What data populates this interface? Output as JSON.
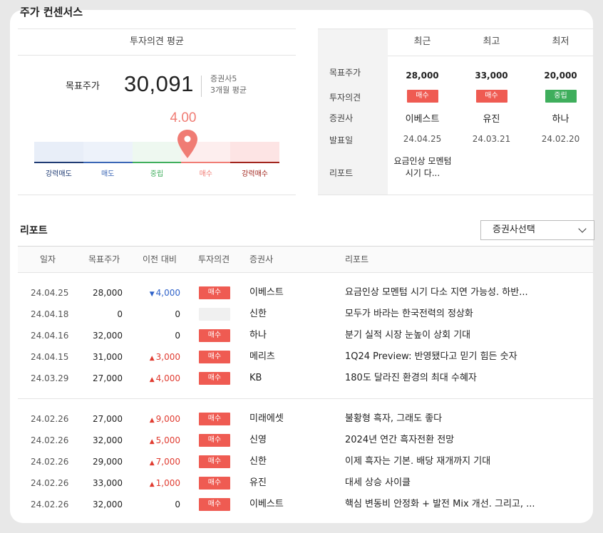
{
  "section_title": "주가 컨센서스",
  "opinion": {
    "title": "투자의견 평균",
    "target_label": "목표주가",
    "target_value": "30,091",
    "meta_line1": "증권사5",
    "meta_line2": "3개월 평균",
    "score": "4.00",
    "score_fraction": 0.625,
    "gauge": [
      {
        "label": "강력매도",
        "bg": "#e8eef8",
        "bar": "#1f3b73",
        "text": "#1f3b73"
      },
      {
        "label": "매도",
        "bg": "#edf2fa",
        "bar": "#3a66b5",
        "text": "#3a66b5"
      },
      {
        "label": "중립",
        "bg": "#eef8f0",
        "bar": "#3fae5c",
        "text": "#3fae5c"
      },
      {
        "label": "매수",
        "bg": "#fdeeee",
        "bar": "#f07c74",
        "text": "#f07c74"
      },
      {
        "label": "강력매수",
        "bg": "#fde4e4",
        "bar": "#a1241c",
        "text": "#a1241c"
      }
    ]
  },
  "summary": {
    "headers": [
      "최근",
      "최고",
      "최저"
    ],
    "row_labels": [
      "목표주가",
      "투자의견",
      "증권사",
      "발표일",
      "리포트"
    ],
    "columns": [
      {
        "target": "28,000",
        "opinion": "매수",
        "opinion_type": "buy",
        "firm": "이베스트",
        "date": "24.04.25",
        "report": "요금인상 모멘텀 시기 다..."
      },
      {
        "target": "33,000",
        "opinion": "매수",
        "opinion_type": "buy",
        "firm": "유진",
        "date": "24.03.21",
        "report": ""
      },
      {
        "target": "20,000",
        "opinion": "중립",
        "opinion_type": "neutral",
        "firm": "하나",
        "date": "24.02.20",
        "report": ""
      }
    ]
  },
  "reports": {
    "title": "리포트",
    "select_label": "증권사선택",
    "headers": {
      "date": "일자",
      "target": "목표주가",
      "change": "이전 대비",
      "opinion": "투자의견",
      "firm": "증권사",
      "report": "리포트"
    },
    "rows": [
      {
        "date": "24.04.25",
        "target": "28,000",
        "change": "4,000",
        "dir": "down",
        "opinion": "매수",
        "firm": "이베스트",
        "report": "요금인상 모멘텀 시기 다소 지연 가능성. 하반..."
      },
      {
        "date": "24.04.18",
        "target": "0",
        "change": "0",
        "dir": "flat",
        "opinion": "",
        "firm": "신한",
        "report": "모두가 바라는 한국전력의 정상화"
      },
      {
        "date": "24.04.16",
        "target": "32,000",
        "change": "0",
        "dir": "flat",
        "opinion": "매수",
        "firm": "하나",
        "report": "분기 실적 시장 눈높이 상회 기대"
      },
      {
        "date": "24.04.15",
        "target": "31,000",
        "change": "3,000",
        "dir": "up",
        "opinion": "매수",
        "firm": "메리츠",
        "report": "1Q24 Preview: 반영됐다고 믿기 힘든 숫자"
      },
      {
        "date": "24.03.29",
        "target": "27,000",
        "change": "4,000",
        "dir": "up",
        "opinion": "매수",
        "firm": "KB",
        "report": "180도 달라진 환경의 최대 수혜자"
      },
      {
        "date": "24.02.26",
        "target": "27,000",
        "change": "9,000",
        "dir": "up",
        "opinion": "매수",
        "firm": "미래에셋",
        "report": "불황형 흑자, 그래도 좋다"
      },
      {
        "date": "24.02.26",
        "target": "32,000",
        "change": "5,000",
        "dir": "up",
        "opinion": "매수",
        "firm": "신영",
        "report": "2024년 연간 흑자전환 전망"
      },
      {
        "date": "24.02.26",
        "target": "29,000",
        "change": "7,000",
        "dir": "up",
        "opinion": "매수",
        "firm": "신한",
        "report": "이제 흑자는 기본. 배당 재개까지 기대"
      },
      {
        "date": "24.02.26",
        "target": "33,000",
        "change": "1,000",
        "dir": "up",
        "opinion": "매수",
        "firm": "유진",
        "report": "대세 상승 사이클"
      },
      {
        "date": "24.02.26",
        "target": "32,000",
        "change": "0",
        "dir": "flat",
        "opinion": "매수",
        "firm": "이베스트",
        "report": "핵심 변동비 안정화 + 발전 Mix 개선. 그리고, ..."
      }
    ]
  }
}
